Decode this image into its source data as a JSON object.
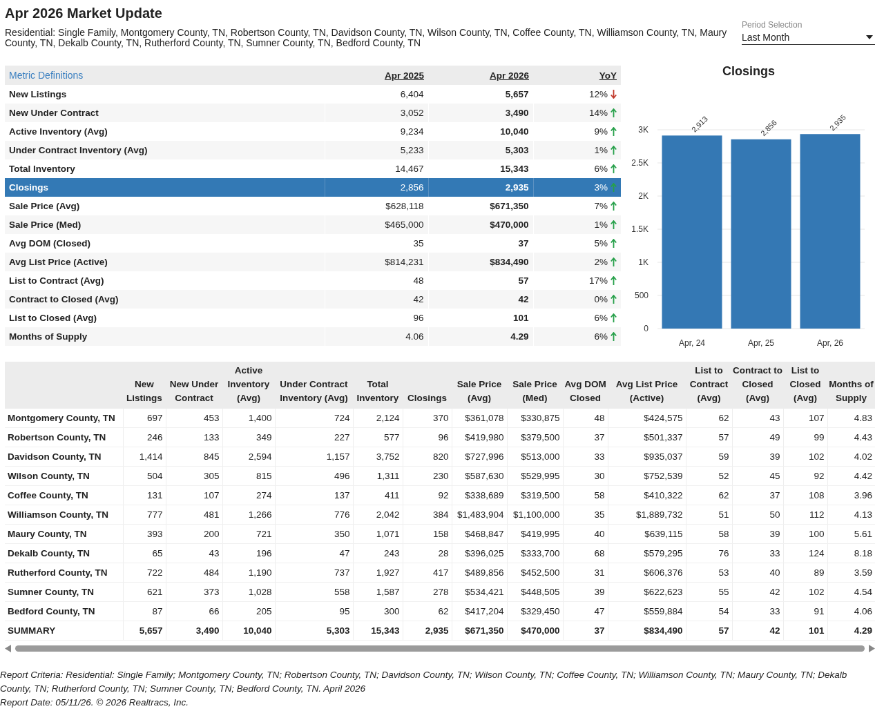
{
  "title": "Apr 2026 Market Update",
  "subtitle": "Residential: Single Family, Montgomery County, TN, Robertson County, TN, Davidson County, TN, Wilson County, TN, Coffee County, TN, Williamson County, TN, Maury County, TN, Dekalb County, TN, Rutherford County, TN, Sumner County, TN, Bedford County, TN",
  "period_selection": {
    "label": "Period Selection",
    "value": "Last Month"
  },
  "metrics": {
    "link": "Metric Definitions",
    "columns": [
      "Apr 2025",
      "Apr 2026",
      "YoY"
    ],
    "rows": [
      {
        "name": "New Listings",
        "prev": "6,404",
        "curr": "5,657",
        "yoy": "12%",
        "decreased": true,
        "selected": false
      },
      {
        "name": "New Under Contract",
        "prev": "3,052",
        "curr": "3,490",
        "yoy": "14%",
        "decreased": false,
        "selected": false
      },
      {
        "name": "Active Inventory (Avg)",
        "prev": "9,234",
        "curr": "10,040",
        "yoy": "9%",
        "decreased": false,
        "selected": false
      },
      {
        "name": "Under Contract Inventory (Avg)",
        "prev": "5,233",
        "curr": "5,303",
        "yoy": "1%",
        "decreased": false,
        "selected": false
      },
      {
        "name": "Total Inventory",
        "prev": "14,467",
        "curr": "15,343",
        "yoy": "6%",
        "decreased": false,
        "selected": false
      },
      {
        "name": "Closings",
        "prev": "2,856",
        "curr": "2,935",
        "yoy": "3%",
        "decreased": false,
        "selected": true
      },
      {
        "name": "Sale Price (Avg)",
        "prev": "$628,118",
        "curr": "$671,350",
        "yoy": "7%",
        "decreased": false,
        "selected": false
      },
      {
        "name": "Sale Price (Med)",
        "prev": "$465,000",
        "curr": "$470,000",
        "yoy": "1%",
        "decreased": false,
        "selected": false
      },
      {
        "name": "Avg DOM (Closed)",
        "prev": "35",
        "curr": "37",
        "yoy": "5%",
        "decreased": false,
        "selected": false
      },
      {
        "name": "Avg List Price (Active)",
        "prev": "$814,231",
        "curr": "$834,490",
        "yoy": "2%",
        "decreased": false,
        "selected": false
      },
      {
        "name": "List to Contract (Avg)",
        "prev": "48",
        "curr": "57",
        "yoy": "17%",
        "decreased": false,
        "selected": false
      },
      {
        "name": "Contract to Closed (Avg)",
        "prev": "42",
        "curr": "42",
        "yoy": "0%",
        "decreased": false,
        "selected": false
      },
      {
        "name": "List to Closed (Avg)",
        "prev": "96",
        "curr": "101",
        "yoy": "6%",
        "decreased": false,
        "selected": false
      },
      {
        "name": "Months of Supply",
        "prev": "4.06",
        "curr": "4.29",
        "yoy": "6%",
        "decreased": false,
        "selected": false
      }
    ]
  },
  "chart": {
    "chart_data": {
      "type": "bar",
      "title": "Closings",
      "categories": [
        "Apr, 24",
        "Apr, 25",
        "Apr, 26"
      ],
      "series": [
        {
          "color": "#3478b4",
          "values": [
            2913,
            2856,
            2935
          ]
        }
      ],
      "ylim": [
        0,
        3000
      ],
      "grid": true,
      "yticks": [
        {
          "value": 0,
          "label": "0"
        },
        {
          "value": 500,
          "label": "500"
        },
        {
          "value": 1000,
          "label": "1K"
        },
        {
          "value": 1500,
          "label": "1.5K"
        },
        {
          "value": 2000,
          "label": "2K"
        },
        {
          "value": 2500,
          "label": "2.5K"
        },
        {
          "value": 3000,
          "label": "3K"
        }
      ],
      "value_labels": [
        "2,913",
        "2,856",
        "2,935"
      ]
    }
  },
  "counties": {
    "columns": [
      "New Listings",
      "New Under Contract",
      "Active Inventory (Avg)",
      "Under Contract Inventory (Avg)",
      "Total Inventory",
      "Closings",
      "Sale Price (Avg)",
      "Sale Price (Med)",
      "Avg DOM Closed",
      "Avg List Price (Active)",
      "List to Contract (Avg)",
      "Contract to Closed (Avg)",
      "List to Closed (Avg)",
      "Months of Supply"
    ],
    "rows": [
      {
        "name": "Montgomery County, TN",
        "values": [
          "697",
          "453",
          "1,400",
          "724",
          "2,124",
          "370",
          "$361,078",
          "$330,875",
          "48",
          "$424,575",
          "62",
          "43",
          "107",
          "4.83"
        ]
      },
      {
        "name": "Robertson County, TN",
        "values": [
          "246",
          "133",
          "349",
          "227",
          "577",
          "96",
          "$419,980",
          "$379,500",
          "37",
          "$501,337",
          "57",
          "49",
          "99",
          "4.43"
        ]
      },
      {
        "name": "Davidson County, TN",
        "values": [
          "1,414",
          "845",
          "2,594",
          "1,157",
          "3,752",
          "820",
          "$727,996",
          "$513,000",
          "33",
          "$935,037",
          "59",
          "39",
          "102",
          "4.02"
        ]
      },
      {
        "name": "Wilson County, TN",
        "values": [
          "504",
          "305",
          "815",
          "496",
          "1,311",
          "230",
          "$587,630",
          "$529,995",
          "30",
          "$752,539",
          "52",
          "45",
          "92",
          "4.42"
        ]
      },
      {
        "name": "Coffee County, TN",
        "values": [
          "131",
          "107",
          "274",
          "137",
          "411",
          "92",
          "$338,689",
          "$319,500",
          "58",
          "$410,322",
          "62",
          "37",
          "108",
          "3.96"
        ]
      },
      {
        "name": "Williamson County, TN",
        "values": [
          "777",
          "481",
          "1,266",
          "776",
          "2,042",
          "384",
          "$1,483,904",
          "$1,100,000",
          "35",
          "$1,889,732",
          "51",
          "50",
          "112",
          "4.13"
        ]
      },
      {
        "name": "Maury County, TN",
        "values": [
          "393",
          "200",
          "721",
          "350",
          "1,071",
          "158",
          "$468,847",
          "$419,995",
          "40",
          "$639,115",
          "58",
          "39",
          "100",
          "5.61"
        ]
      },
      {
        "name": "Dekalb County, TN",
        "values": [
          "65",
          "43",
          "196",
          "47",
          "243",
          "28",
          "$396,025",
          "$333,700",
          "68",
          "$579,295",
          "76",
          "33",
          "124",
          "8.18"
        ]
      },
      {
        "name": "Rutherford County, TN",
        "values": [
          "722",
          "484",
          "1,190",
          "737",
          "1,927",
          "417",
          "$489,856",
          "$452,500",
          "31",
          "$606,376",
          "53",
          "40",
          "89",
          "3.59"
        ]
      },
      {
        "name": "Sumner County, TN",
        "values": [
          "621",
          "373",
          "1,028",
          "558",
          "1,587",
          "278",
          "$534,421",
          "$448,505",
          "39",
          "$622,623",
          "55",
          "42",
          "102",
          "4.54"
        ]
      },
      {
        "name": "Bedford County, TN",
        "values": [
          "87",
          "66",
          "205",
          "95",
          "300",
          "62",
          "$417,204",
          "$329,450",
          "47",
          "$559,884",
          "54",
          "33",
          "91",
          "4.06"
        ]
      }
    ],
    "summary": {
      "name": "SUMMARY",
      "values": [
        "5,657",
        "3,490",
        "10,040",
        "5,303",
        "15,343",
        "2,935",
        "$671,350",
        "$470,000",
        "37",
        "$834,490",
        "57",
        "42",
        "101",
        "4.29"
      ]
    }
  },
  "footer": {
    "criteria": "Report Criteria: Residential: Single Family; Montgomery County, TN; Robertson County, TN; Davidson County, TN; Wilson County, TN; Coffee County, TN; Williamson County, TN; Maury County, TN; Dekalb County, TN; Rutherford County, TN; Sumner County, TN; Bedford County, TN. April 2026",
    "report_date": "Report Date: 05/11/26. © 2026 Realtracs, Inc."
  }
}
